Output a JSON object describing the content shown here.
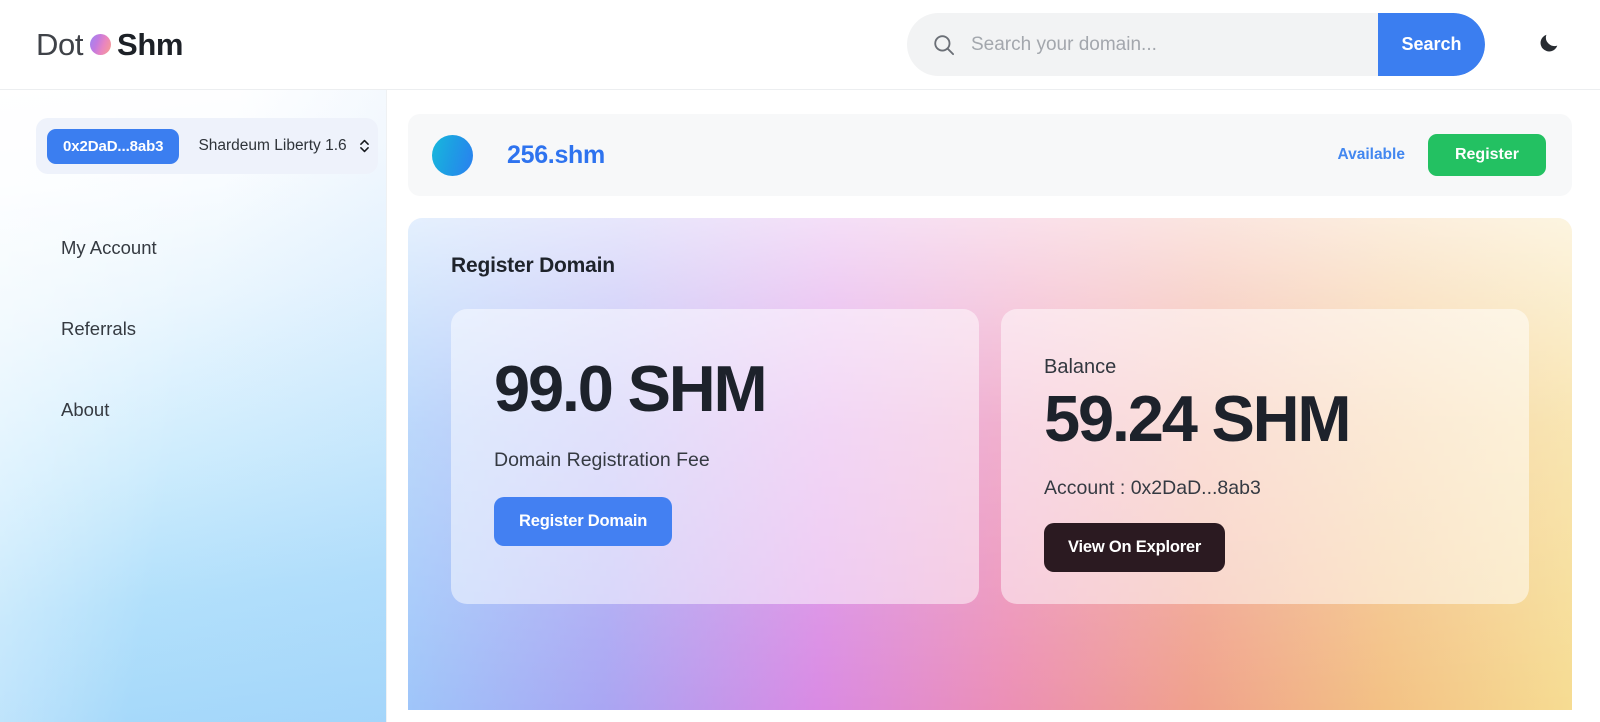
{
  "header": {
    "logo": {
      "part1": "Dot",
      "part2": "Shm",
      "mark_icon": "gradient-dot-icon"
    },
    "search": {
      "placeholder": "Search your domain...",
      "value": "",
      "button_label": "Search",
      "icon": "search-icon"
    },
    "theme_toggle": {
      "icon": "moon-icon",
      "label": "Dark mode"
    }
  },
  "sidebar": {
    "wallet": {
      "address": "0x2DaD...8ab3",
      "network": "Shardeum Liberty 1.6",
      "select_icon": "chevron-updown-icon"
    },
    "nav_items": [
      {
        "label": "My Account"
      },
      {
        "label": "Referrals"
      },
      {
        "label": "About"
      }
    ]
  },
  "main": {
    "domain_result": {
      "avatar_icon": "domain-avatar-icon",
      "name": "256.shm",
      "status": "Available",
      "register_label": "Register"
    },
    "panel": {
      "title": "Register Domain",
      "fee_card": {
        "amount": "99.0 SHM",
        "label": "Domain Registration Fee",
        "button_label": "Register Domain"
      },
      "balance_card": {
        "label": "Balance",
        "amount": "59.24 SHM",
        "account": "Account : 0x2DaD...8ab3",
        "button_label": "View On Explorer"
      }
    }
  },
  "colors": {
    "accent_blue": "#3b7ef0",
    "success_green": "#23c162",
    "dark_button": "#2b1a21",
    "text_dark": "#1d222b"
  }
}
